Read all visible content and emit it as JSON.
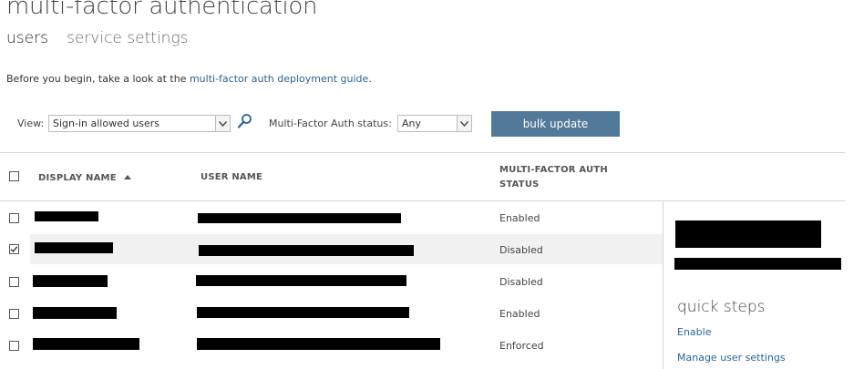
{
  "header": {
    "title": "multi-factor authentication"
  },
  "tabs": [
    {
      "label": "users",
      "active": true
    },
    {
      "label": "service settings",
      "active": false
    }
  ],
  "intro": {
    "text": "Before you begin, take a look at the ",
    "link": "multi-factor auth deployment guide",
    "suffix": "."
  },
  "filters": {
    "view_label": "View:",
    "view_value": "Sign-in allowed users",
    "status_label": "Multi-Factor Auth status:",
    "status_value": "Any",
    "bulk_update_label": "bulk update"
  },
  "table": {
    "columns": {
      "display_name": "DISPLAY NAME",
      "user_name": "USER NAME",
      "mfa_status_line1": "MULTI-FACTOR AUTH",
      "mfa_status_line2": "STATUS"
    },
    "rows": [
      {
        "status": "Enabled",
        "checked": false,
        "selected": false
      },
      {
        "status": "Disabled",
        "checked": true,
        "selected": true
      },
      {
        "status": "Disabled",
        "checked": false,
        "selected": false
      },
      {
        "status": "Enabled",
        "checked": false,
        "selected": false
      },
      {
        "status": "Enforced",
        "checked": false,
        "selected": false
      }
    ]
  },
  "quick_steps": {
    "title": "quick steps",
    "links": [
      "Enable",
      "Manage user settings"
    ]
  },
  "colors": {
    "accent": "#517a99",
    "link": "#2a6496",
    "selected_row": "#f1f1f1",
    "divider": "#d6d6d6"
  }
}
